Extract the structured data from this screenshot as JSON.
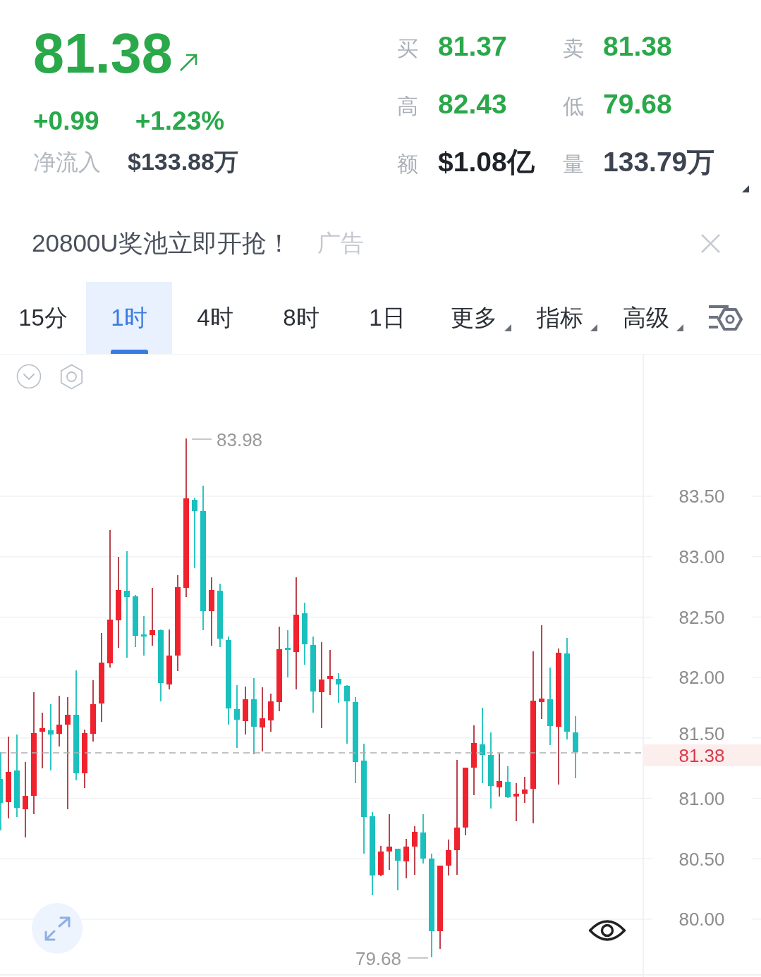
{
  "quote": {
    "price": "81.38",
    "change": "+0.99",
    "change_percent": "+1.23%",
    "net_inflow_label": "净流入",
    "net_inflow": "$133.88万"
  },
  "stats": [
    {
      "label": "买",
      "value": "81.37",
      "kind": "price"
    },
    {
      "label": "卖",
      "value": "81.38",
      "kind": "price"
    },
    {
      "label": "高",
      "value": "82.43",
      "kind": "price"
    },
    {
      "label": "低",
      "value": "79.68",
      "kind": "price"
    },
    {
      "label": "额",
      "value": "$1.08亿",
      "kind": "turnover"
    },
    {
      "label": "量",
      "value": "133.79万",
      "kind": "volume"
    }
  ],
  "ad": {
    "text": "20800U奖池立即开抢！",
    "tag": "广告"
  },
  "tabs": [
    {
      "label": "15分",
      "kind": "interval",
      "selected": false
    },
    {
      "label": "1时",
      "kind": "interval",
      "selected": true
    },
    {
      "label": "4时",
      "kind": "interval",
      "selected": false
    },
    {
      "label": "8时",
      "kind": "interval",
      "selected": false
    },
    {
      "label": "1日",
      "kind": "interval",
      "selected": false
    },
    {
      "label": "更多",
      "kind": "menu",
      "selected": false
    },
    {
      "label": "指标",
      "kind": "menu",
      "selected": false
    },
    {
      "label": "高级",
      "kind": "menu",
      "selected": false
    }
  ],
  "chart": {
    "price_axis_labels": [
      "83.50",
      "83.00",
      "82.50",
      "82.00",
      "81.50",
      "81.00",
      "80.50",
      "80.00"
    ],
    "high_marker": "83.98",
    "low_marker": "79.68",
    "last_price_tag": "81.38"
  }
}
